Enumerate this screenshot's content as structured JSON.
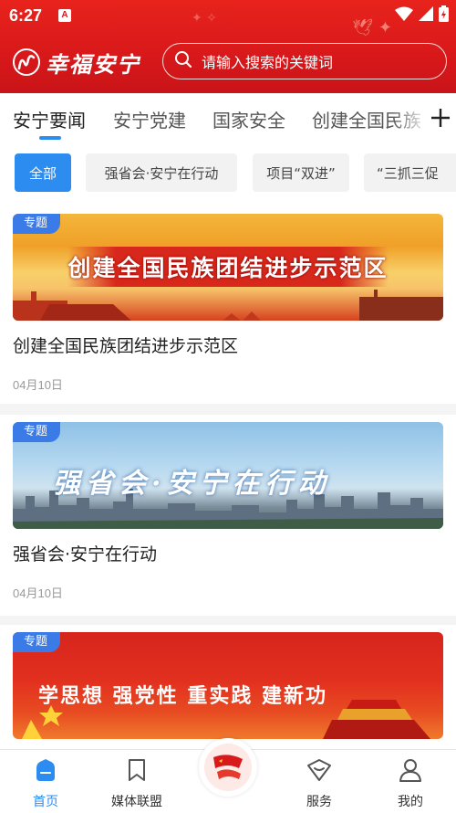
{
  "status_bar": {
    "time": "6:27",
    "badge": "A"
  },
  "header": {
    "logo_text": "幸福安宁"
  },
  "search": {
    "placeholder": "请输入搜索的关键词"
  },
  "tabs": [
    {
      "label": "安宁要闻",
      "active": true
    },
    {
      "label": "安宁党建",
      "active": false
    },
    {
      "label": "国家安全",
      "active": false
    },
    {
      "label": "创建全国民族",
      "active": false
    }
  ],
  "chips": [
    {
      "label": "全部",
      "active": true
    },
    {
      "label": "强省会·安宁在行动",
      "active": false
    },
    {
      "label": "项目“双进”",
      "active": false
    },
    {
      "label": "“三抓三促",
      "active": false
    }
  ],
  "cards": [
    {
      "tag": "专题",
      "banner_text": "创建全国民族团结进步示范区",
      "title": "创建全国民族团结进步示范区",
      "date": "04月10日"
    },
    {
      "tag": "专题",
      "banner_text": "强省会·安宁在行动",
      "title": "强省会·安宁在行动",
      "date": "04月10日"
    },
    {
      "tag": "专题",
      "banner_text": "学思想 强党性 重实践 建新功"
    }
  ],
  "bottom_nav": [
    {
      "label": "首页",
      "icon": "home-icon",
      "active": true
    },
    {
      "label": "媒体联盟",
      "icon": "bookmark-icon",
      "active": false
    },
    {
      "label": "服务",
      "icon": "service-icon",
      "active": false
    },
    {
      "label": "我的",
      "icon": "user-icon",
      "active": false
    }
  ],
  "colors": {
    "brand_red": "#d8181a",
    "accent_blue": "#2d8cf0",
    "tag_blue": "#3b7be8"
  }
}
